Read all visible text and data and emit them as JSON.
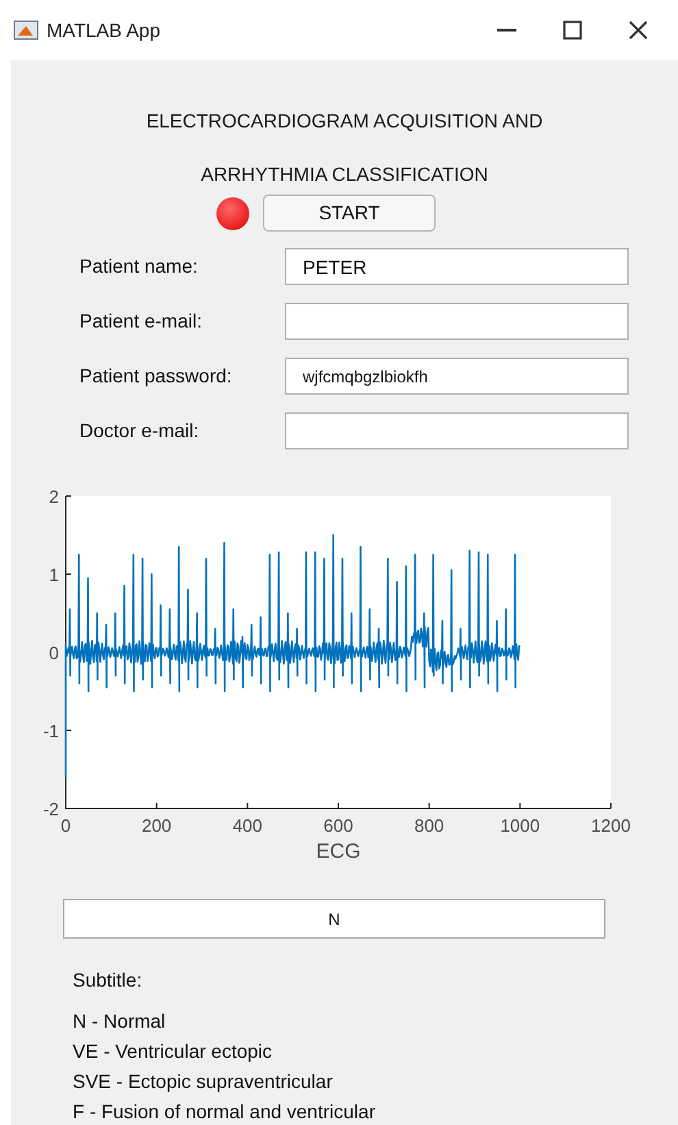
{
  "window": {
    "title": "MATLAB App"
  },
  "heading": [
    "ELECTROCARDIOGRAM ACQUISITION AND",
    "ARRHYTHMIA CLASSIFICATION"
  ],
  "lamp": {
    "on": false
  },
  "start_button": "START",
  "fields": [
    {
      "label": "Patient name:",
      "value": "PETER"
    },
    {
      "label": "Patient e-mail:"
    },
    {
      "label": "Patient password:",
      "value": "wjfcmqbgzlbiokfh"
    },
    {
      "label": "Doctor e-mail:"
    }
  ],
  "plot": {
    "xlabel": "ECG",
    "xticks": [
      "0",
      "200",
      "400",
      "600",
      "800",
      "1000",
      "1200"
    ],
    "yticks": [
      "2",
      "1",
      "0",
      "-1",
      "-2"
    ]
  },
  "result": "N",
  "legend": {
    "title": "Subtitle:",
    "items": [
      "N - Normal",
      "VE - Ventricular ectopic",
      "SVE - Ectopic supraventricular",
      "F - Fusion of normal and ventricular"
    ]
  }
}
